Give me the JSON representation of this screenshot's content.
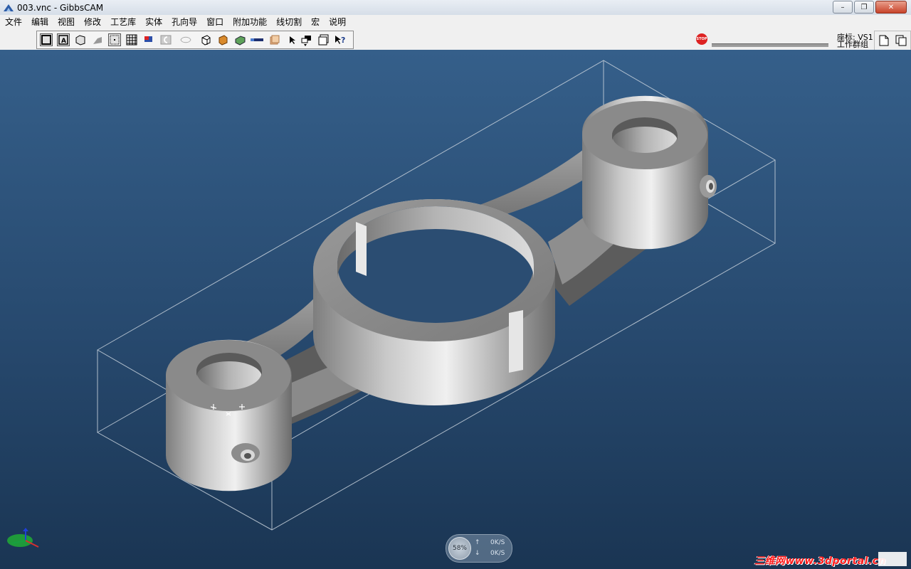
{
  "window": {
    "title": "003.vnc - GibbsCAM",
    "min": "–",
    "max": "❐",
    "close": "✕"
  },
  "menu": [
    "文件",
    "编辑",
    "视图",
    "修改",
    "工艺库",
    "实体",
    "孔向导",
    "窗口",
    "附加功能",
    "线切割",
    "宏",
    "说明"
  ],
  "toolbar": {
    "icons": [
      "view-frame-icon",
      "view-text-icon",
      "view-solid-icon",
      "shade-icon",
      "dotted-select-icon",
      "grid-icon",
      "flag-icon",
      "profile-icon",
      "contour-icon",
      "cube-icon",
      "cube-orange-icon",
      "cube-green-icon",
      "bar-icon",
      "stack-icon",
      "arrow-cursor-icon",
      "fill-icon",
      "layers-icon",
      "whats-this-icon"
    ],
    "stop_label": "STOP",
    "coord_label": "座标: VS1",
    "group_label": "工作群组"
  },
  "palette": {
    "icons": [
      "new-doc-icon",
      "copy-doc-icon",
      "rect-icon",
      "curve-icon",
      "drill-icon",
      "axis-red-icon",
      "pipe-icon",
      "plane-icon",
      "eye-icon",
      "box-icon",
      "pen-icon",
      "render-icon",
      "dim-icon",
      "dim2-icon",
      "group-icon",
      "copy-icon"
    ]
  },
  "status": {
    "percent": "58%",
    "up_arrow": "↑",
    "down_arrow": "↓",
    "up": "0K/S",
    "down": "0K/S"
  },
  "watermark": "三维网www.3dportal.cn"
}
